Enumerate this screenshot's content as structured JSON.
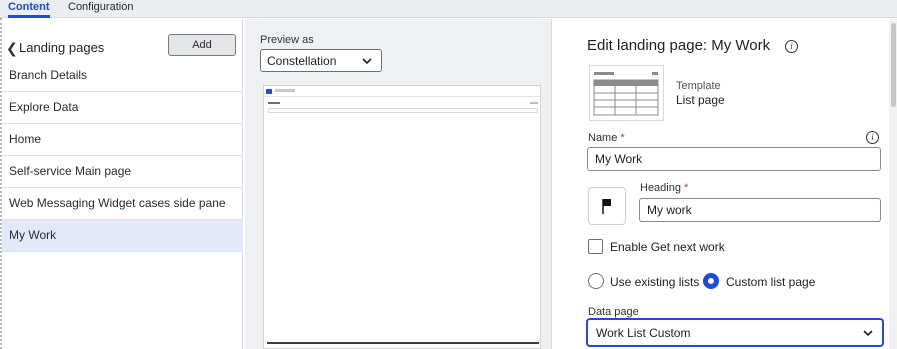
{
  "tabs": [
    {
      "label": "Content",
      "active": true
    },
    {
      "label": "Configuration",
      "active": false
    }
  ],
  "landing_pages": {
    "title": "Landing pages",
    "add_label": "Add",
    "items": [
      {
        "label": "Branch Details",
        "selected": false
      },
      {
        "label": "Explore Data",
        "selected": false
      },
      {
        "label": "Home",
        "selected": false
      },
      {
        "label": "Self-service Main page",
        "selected": false
      },
      {
        "label": "Web Messaging Widget cases side pane",
        "selected": false
      },
      {
        "label": "My Work",
        "selected": true
      }
    ]
  },
  "preview": {
    "label": "Preview as",
    "selected": "Constellation"
  },
  "editor": {
    "title": "Edit landing page: My Work",
    "template_label": "Template",
    "template_value": "List page",
    "name_label": "Name",
    "name_value": "My Work",
    "heading_label": "Heading",
    "heading_value": "My work",
    "required_mark": "*",
    "enable_get_next_label": "Enable Get next work",
    "enable_get_next_checked": false,
    "radio_existing_label": "Use existing lists",
    "radio_custom_label": "Custom list page",
    "selected_radio": "custom",
    "data_page_label": "Data page",
    "data_page_value": "Work List Custom"
  },
  "colors": {
    "accent": "#1f4bd8",
    "selected_row": "#e3e9f8",
    "preview_bg": "#eef0f4",
    "required": "#c0392b"
  }
}
